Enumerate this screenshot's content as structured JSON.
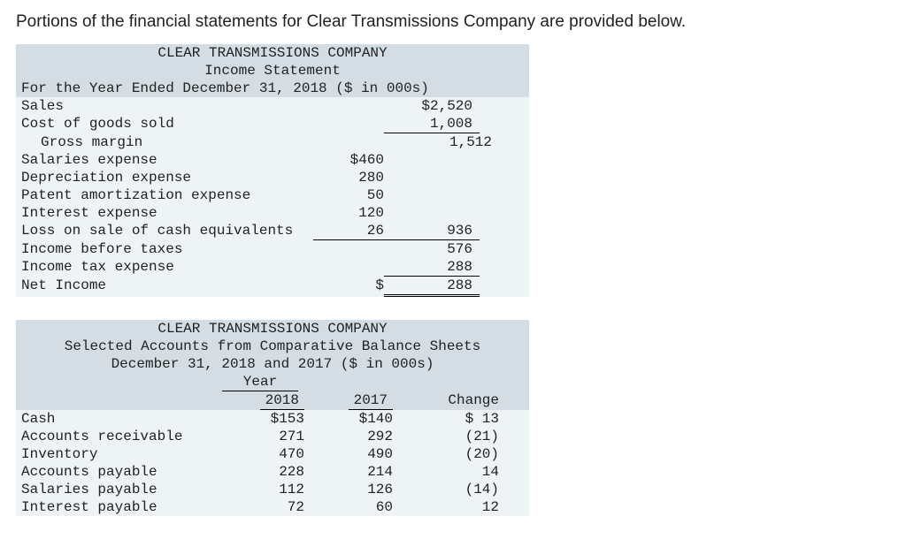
{
  "intro": "Portions of the financial statements for Clear Transmissions Company are provided below.",
  "stmt1": {
    "company": "CLEAR TRANSMISSIONS COMPANY",
    "title": "Income Statement",
    "period": "For the Year Ended December 31, 2018 ($ in 000s)",
    "lines": {
      "sales_label": "Sales",
      "sales_val": "$2,520",
      "cogs_label": "Cost of goods sold",
      "cogs_val": "1,008",
      "gm_label": "Gross margin",
      "gm_val": "1,512",
      "sal_label": "Salaries expense",
      "sal_val": "$460",
      "dep_label": "Depreciation expense",
      "dep_val": "280",
      "pat_label": "Patent amortization expense",
      "pat_val": "50",
      "int_label": "Interest expense",
      "int_val": "120",
      "loss_label": "Loss on sale of cash equivalents",
      "loss_val": "26",
      "loss_total": "936",
      "ibt_label": "Income before taxes",
      "ibt_val": "576",
      "tax_label": "Income tax expense",
      "tax_val": "288",
      "ni_label": "Net Income",
      "ni_sym": "$",
      "ni_val": "288"
    }
  },
  "stmt2": {
    "company": "CLEAR TRANSMISSIONS COMPANY",
    "title": "Selected Accounts from Comparative Balance Sheets",
    "period": "December 31, 2018 and 2017 ($ in 000s)",
    "year_label": "Year",
    "colhdr": {
      "y1": "2018",
      "y2": "2017",
      "chg": "Change"
    },
    "rows": [
      {
        "label": "Cash",
        "a": "$153",
        "b": "$140",
        "c": "$ 13"
      },
      {
        "label": "Accounts receivable",
        "a": "271",
        "b": "292",
        "c": "(21)"
      },
      {
        "label": "Inventory",
        "a": "470",
        "b": "490",
        "c": "(20)"
      },
      {
        "label": "Accounts payable",
        "a": "228",
        "b": "214",
        "c": "14"
      },
      {
        "label": "Salaries payable",
        "a": "112",
        "b": "126",
        "c": "(14)"
      },
      {
        "label": "Interest payable",
        "a": "72",
        "b": "60",
        "c": "12"
      }
    ]
  }
}
